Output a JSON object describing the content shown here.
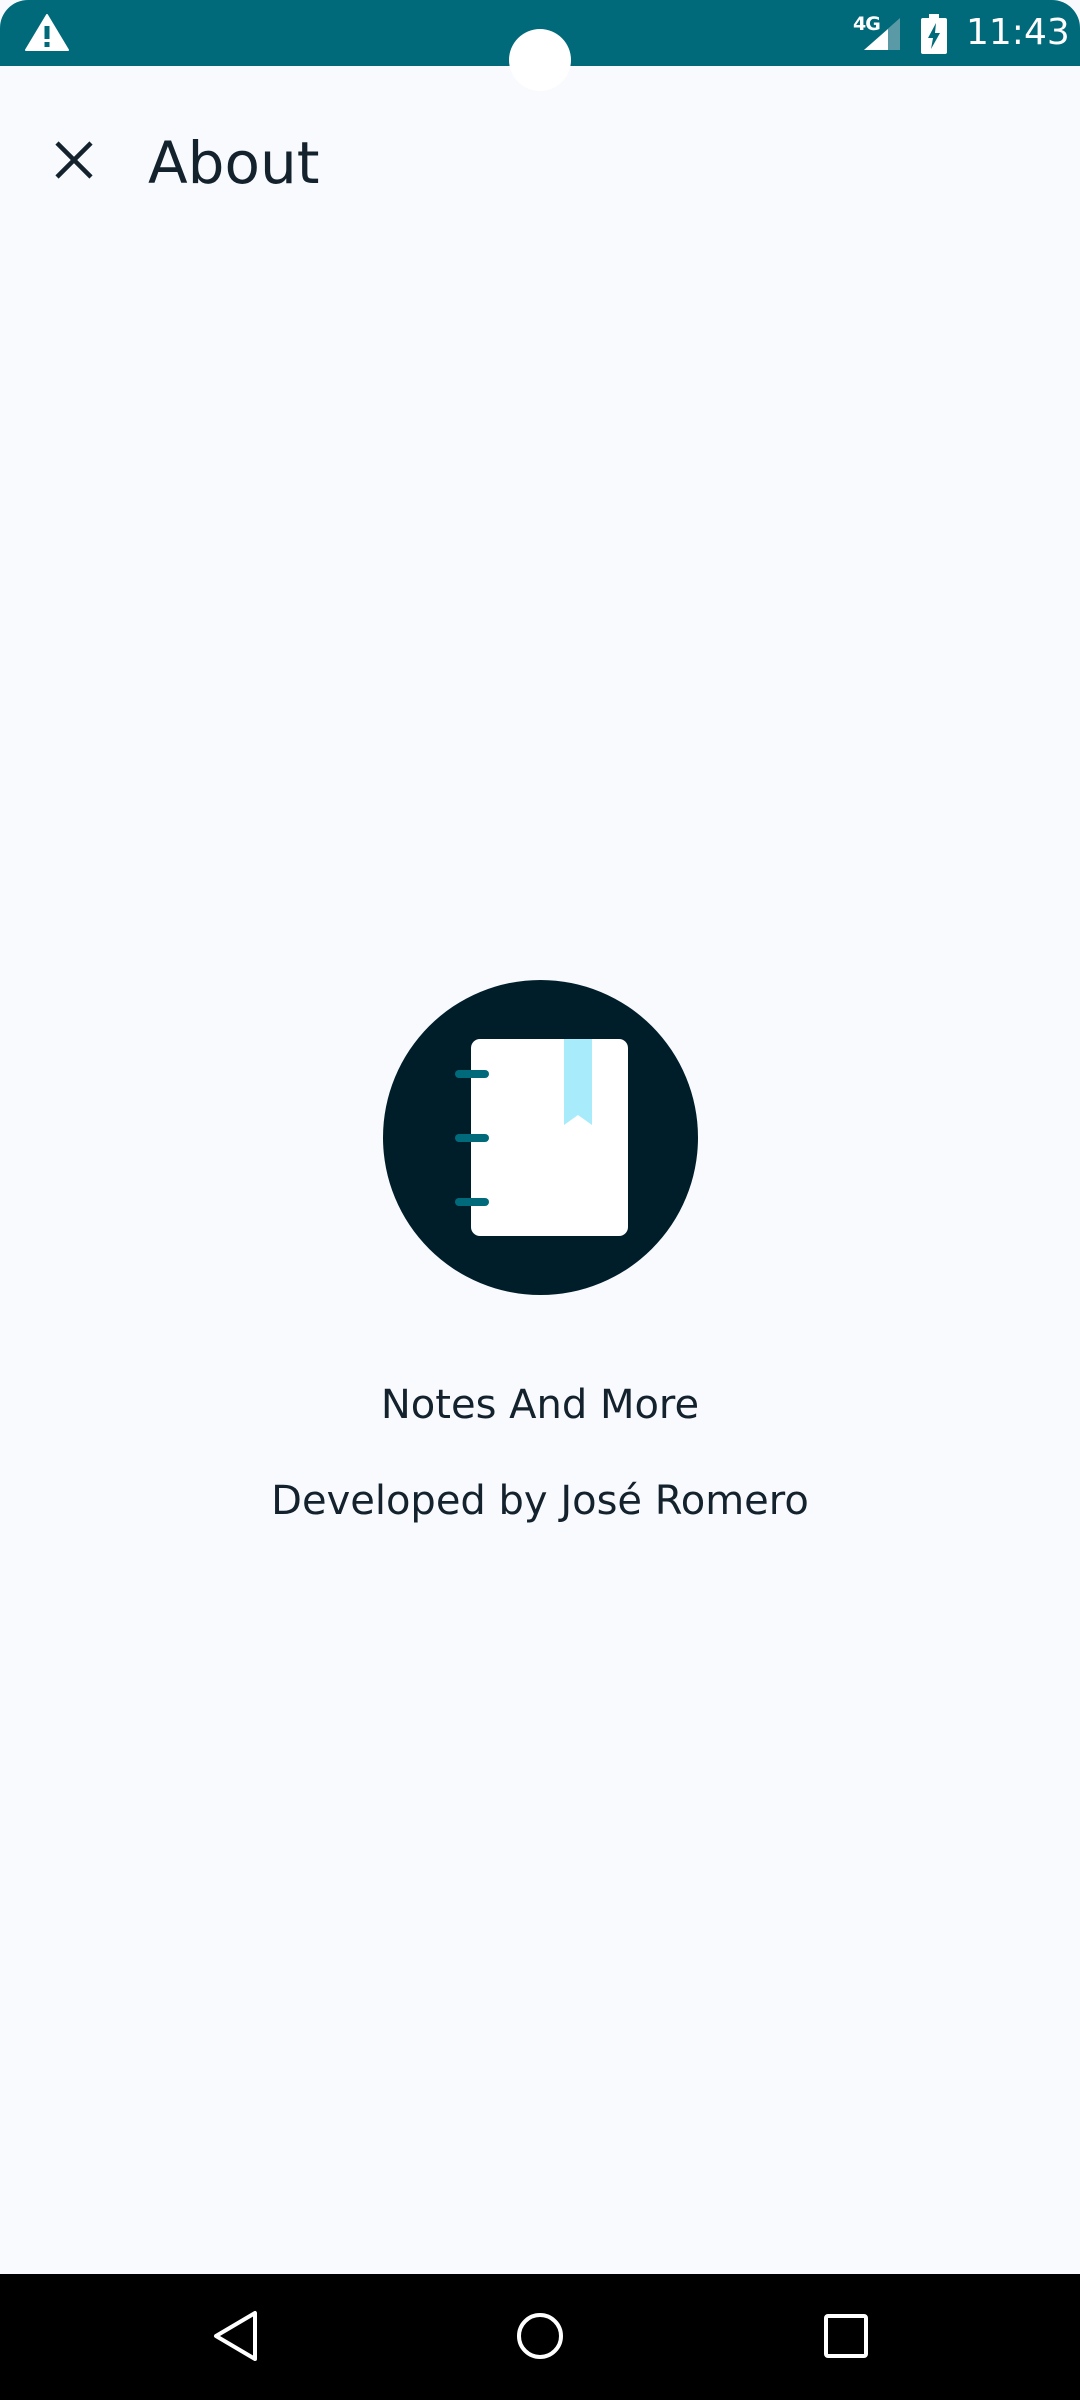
{
  "status_bar": {
    "network": "4G",
    "time": "11:43",
    "icons": [
      "alert-icon",
      "signal-icon",
      "battery-charging-icon"
    ]
  },
  "app_bar": {
    "title": "About",
    "close_icon": "close-icon"
  },
  "about": {
    "logo_icon": "notebook-icon",
    "app_name": "Notes And More",
    "developer": "Developed by José Romero"
  },
  "nav_bar": {
    "icons": [
      "back-icon",
      "home-icon",
      "recents-icon"
    ]
  },
  "colors": {
    "status_bar": "#006a7a",
    "background": "#f8fafe",
    "logo_circle": "#001e2a",
    "bookmark": "#a8ebfb",
    "text": "#13222c"
  }
}
